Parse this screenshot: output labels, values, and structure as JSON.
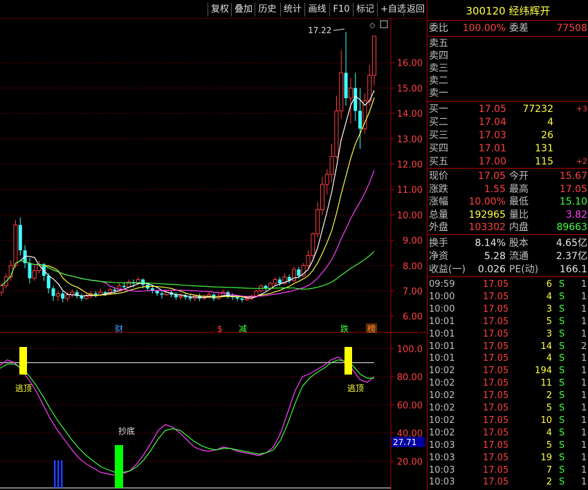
{
  "toolbar": {
    "buttons": [
      "复权",
      "叠加",
      "历史",
      "统计",
      "画线",
      "F10",
      "标记",
      "+自选",
      "返回"
    ]
  },
  "stock": {
    "code": "300120",
    "name": "经纬辉开"
  },
  "main_chart": {
    "price_ticks": [
      "16.00",
      "15.00",
      "14.00",
      "13.00",
      "12.00",
      "11.00",
      "10.00",
      "9.00",
      "8.00",
      "7.00",
      "6.00"
    ],
    "high_marker": "17.22",
    "event_labels": [
      "财",
      "$",
      "减",
      "跌",
      "榜"
    ]
  },
  "indicator_chart": {
    "ticks": [
      "100.0",
      "80.00",
      "60.00",
      "40.00",
      "20.00"
    ],
    "current_value": "27.71",
    "labels": {
      "escape_top_1": "逃顶",
      "escape_top_2": "逃顶",
      "bottom_buy": "抄底"
    }
  },
  "quote": {
    "weibi_label": "委比",
    "weibi_value": "100.00%",
    "weicha_label": "委差",
    "weicha_value": "77508",
    "sell": [
      {
        "label": "卖五"
      },
      {
        "label": "卖四"
      },
      {
        "label": "卖三"
      },
      {
        "label": "卖二"
      },
      {
        "label": "卖一"
      }
    ],
    "buy": [
      {
        "label": "买一",
        "price": "17.05",
        "vol": "77232",
        "chg": "+3"
      },
      {
        "label": "买二",
        "price": "17.04",
        "vol": "4",
        "chg": ""
      },
      {
        "label": "买三",
        "price": "17.03",
        "vol": "26",
        "chg": ""
      },
      {
        "label": "买四",
        "price": "17.01",
        "vol": "131",
        "chg": ""
      },
      {
        "label": "买五",
        "price": "17.00",
        "vol": "115",
        "chg": "+2"
      }
    ],
    "stats": [
      {
        "l1": "现价",
        "v1": "17.05",
        "c1": "red",
        "l2": "今开",
        "v2": "15.67",
        "c2": "red"
      },
      {
        "l1": "涨跌",
        "v1": "1.55",
        "c1": "red",
        "l2": "最高",
        "v2": "17.05",
        "c2": "red"
      },
      {
        "l1": "涨幅",
        "v1": "10.00%",
        "c1": "red",
        "l2": "最低",
        "v2": "15.10",
        "c2": "green"
      },
      {
        "l1": "总量",
        "v1": "192965",
        "c1": "yellow",
        "l2": "量比",
        "v2": "3.82",
        "c2": "magenta"
      },
      {
        "l1": "外盘",
        "v1": "103302",
        "c1": "red",
        "l2": "内盘",
        "v2": "89663",
        "c2": "green"
      }
    ],
    "stats2": [
      {
        "l1": "换手",
        "v1": "8.14%",
        "l2": "股本",
        "v2": "4.65亿"
      },
      {
        "l1": "净资",
        "v1": "5.28",
        "l2": "流通",
        "v2": "2.37亿"
      },
      {
        "l1": "收益(一)",
        "v1": "0.026",
        "l2": "PE(动)",
        "v2": "166.1"
      }
    ]
  },
  "ticks": [
    {
      "time": "09:59",
      "price": "17.05",
      "vol": "6",
      "side": "S",
      "cnt": "1"
    },
    {
      "time": "10:00",
      "price": "17.05",
      "vol": "4",
      "side": "S",
      "cnt": "1"
    },
    {
      "time": "10:00",
      "price": "17.05",
      "vol": "3",
      "side": "S",
      "cnt": "1"
    },
    {
      "time": "10:01",
      "price": "17.05",
      "vol": "5",
      "side": "S",
      "cnt": "1"
    },
    {
      "time": "10:01",
      "price": "17.05",
      "vol": "3",
      "side": "S",
      "cnt": "1"
    },
    {
      "time": "10:01",
      "price": "17.05",
      "vol": "14",
      "side": "S",
      "cnt": "2"
    },
    {
      "time": "10:01",
      "price": "17.05",
      "vol": "4",
      "side": "S",
      "cnt": "1"
    },
    {
      "time": "10:02",
      "price": "17.05",
      "vol": "194",
      "side": "S",
      "cnt": "1"
    },
    {
      "time": "10:02",
      "price": "17.05",
      "vol": "11",
      "side": "S",
      "cnt": "1"
    },
    {
      "time": "10:02",
      "price": "17.05",
      "vol": "2",
      "side": "S",
      "cnt": "1"
    },
    {
      "time": "10:02",
      "price": "17.05",
      "vol": "5",
      "side": "S",
      "cnt": "1"
    },
    {
      "time": "10:02",
      "price": "17.05",
      "vol": "10",
      "side": "S",
      "cnt": "1"
    },
    {
      "time": "10:02",
      "price": "17.05",
      "vol": "4",
      "side": "S",
      "cnt": "1"
    },
    {
      "time": "10:03",
      "price": "17.05",
      "vol": "5",
      "side": "S",
      "cnt": "1"
    },
    {
      "time": "10:03",
      "price": "17.05",
      "vol": "19",
      "side": "S",
      "cnt": "1"
    },
    {
      "time": "10:03",
      "price": "17.05",
      "vol": "7",
      "side": "S",
      "cnt": "1"
    },
    {
      "time": "10:03",
      "price": "17.05",
      "vol": "2",
      "side": "S",
      "cnt": "1"
    }
  ],
  "colors": {
    "up": "#ff4040",
    "down": "#40ffff",
    "ma5": "#ffffff",
    "ma10": "#ffff40",
    "ma20": "#ff40ff",
    "ma60": "#40ff40",
    "grid": "#b00000"
  },
  "chart_data": {
    "type": "candlestick",
    "price_range": [
      5.5,
      17.6
    ],
    "candles": [
      [
        6.95,
        7.2,
        6.8,
        7.3
      ],
      [
        7.2,
        7.55,
        7.1,
        7.7
      ],
      [
        7.55,
        8.0,
        7.4,
        8.2
      ],
      [
        8.0,
        9.6,
        7.9,
        9.8
      ],
      [
        9.6,
        8.6,
        8.4,
        9.9
      ],
      [
        8.6,
        8.1,
        7.9,
        8.8
      ],
      [
        8.1,
        7.5,
        7.3,
        8.3
      ],
      [
        7.5,
        7.8,
        7.4,
        8.0
      ],
      [
        7.8,
        8.05,
        7.7,
        8.2
      ],
      [
        8.05,
        7.6,
        7.4,
        8.1
      ],
      [
        7.6,
        7.1,
        6.9,
        7.7
      ],
      [
        7.1,
        6.8,
        6.6,
        7.2
      ],
      [
        6.8,
        6.9,
        6.6,
        7.0
      ],
      [
        6.9,
        6.7,
        6.55,
        7.0
      ],
      [
        6.7,
        6.85,
        6.6,
        6.95
      ],
      [
        6.85,
        6.95,
        6.75,
        7.05
      ],
      [
        6.95,
        6.8,
        6.7,
        7.05
      ],
      [
        6.8,
        6.7,
        6.6,
        6.9
      ],
      [
        6.7,
        6.8,
        6.65,
        6.9
      ],
      [
        6.8,
        6.9,
        6.7,
        7.0
      ],
      [
        6.9,
        6.85,
        6.75,
        7.0
      ],
      [
        6.85,
        6.95,
        6.8,
        7.1
      ],
      [
        6.95,
        6.9,
        6.8,
        7.0
      ],
      [
        6.9,
        7.05,
        6.85,
        7.15
      ],
      [
        7.05,
        7.0,
        6.9,
        7.15
      ],
      [
        7.0,
        7.2,
        6.95,
        7.3
      ],
      [
        7.2,
        7.15,
        7.05,
        7.35
      ],
      [
        7.15,
        7.35,
        7.1,
        7.45
      ],
      [
        7.35,
        7.3,
        7.15,
        7.45
      ],
      [
        7.3,
        7.45,
        7.25,
        7.55
      ],
      [
        7.45,
        7.25,
        7.1,
        7.5
      ],
      [
        7.25,
        7.1,
        7.0,
        7.3
      ],
      [
        7.1,
        7.0,
        6.9,
        7.2
      ],
      [
        7.0,
        6.9,
        6.8,
        7.05
      ],
      [
        6.9,
        6.85,
        6.7,
        7.0
      ],
      [
        6.85,
        6.95,
        6.8,
        7.05
      ],
      [
        6.95,
        6.85,
        6.75,
        7.0
      ],
      [
        6.85,
        6.75,
        6.65,
        6.95
      ],
      [
        6.75,
        6.8,
        6.65,
        6.9
      ],
      [
        6.8,
        6.75,
        6.65,
        6.9
      ],
      [
        6.75,
        6.7,
        6.6,
        6.85
      ],
      [
        6.7,
        6.8,
        6.6,
        6.85
      ],
      [
        6.8,
        6.7,
        6.6,
        6.9
      ],
      [
        6.7,
        6.75,
        6.65,
        6.85
      ],
      [
        6.75,
        6.85,
        6.7,
        6.95
      ],
      [
        6.85,
        6.7,
        6.6,
        6.9
      ],
      [
        6.7,
        6.8,
        6.65,
        6.9
      ],
      [
        6.8,
        6.95,
        6.75,
        7.05
      ],
      [
        6.95,
        6.8,
        6.7,
        7.0
      ],
      [
        6.8,
        6.75,
        6.65,
        6.9
      ],
      [
        6.75,
        6.7,
        6.6,
        6.8
      ],
      [
        6.7,
        6.65,
        6.55,
        6.75
      ],
      [
        6.65,
        6.7,
        6.6,
        6.75
      ],
      [
        6.7,
        6.8,
        6.65,
        6.85
      ],
      [
        6.8,
        7.0,
        6.75,
        7.05
      ],
      [
        7.0,
        7.2,
        6.95,
        7.25
      ],
      [
        7.2,
        7.1,
        7.0,
        7.25
      ],
      [
        7.1,
        7.3,
        7.05,
        7.35
      ],
      [
        7.3,
        7.45,
        7.2,
        7.55
      ],
      [
        7.45,
        7.3,
        7.2,
        7.55
      ],
      [
        7.3,
        7.55,
        7.25,
        7.7
      ],
      [
        7.55,
        7.4,
        7.3,
        7.65
      ],
      [
        7.4,
        7.85,
        7.35,
        7.95
      ],
      [
        7.85,
        7.6,
        7.5,
        7.95
      ],
      [
        7.6,
        8.0,
        7.55,
        8.1
      ],
      [
        8.0,
        8.4,
        7.9,
        8.6
      ],
      [
        8.4,
        9.25,
        8.3,
        9.3
      ],
      [
        9.25,
        10.2,
        9.1,
        10.5
      ],
      [
        10.2,
        11.2,
        10.0,
        11.5
      ],
      [
        11.2,
        11.6,
        10.8,
        11.8
      ],
      [
        11.6,
        12.3,
        11.3,
        12.8
      ],
      [
        12.3,
        14.1,
        12.2,
        14.7
      ],
      [
        14.1,
        15.6,
        13.8,
        16.5
      ],
      [
        15.6,
        14.6,
        14.3,
        17.22
      ],
      [
        14.6,
        15.0,
        13.6,
        15.4
      ],
      [
        15.0,
        14.1,
        13.7,
        15.6
      ],
      [
        14.1,
        13.4,
        12.6,
        15.0
      ],
      [
        13.4,
        14.5,
        13.2,
        14.8
      ],
      [
        14.5,
        15.5,
        14.3,
        15.9
      ],
      [
        15.5,
        17.05,
        15.1,
        17.05
      ]
    ],
    "ma_series": [
      "MA5",
      "MA10",
      "MA20",
      "MA60"
    ],
    "indicator_range": [
      0,
      110
    ],
    "indicator_threshold": 90,
    "indicator_k": [
      88,
      92,
      90,
      85,
      78,
      70,
      60,
      50,
      42,
      35,
      28,
      22,
      18,
      15,
      12,
      11,
      10,
      11,
      13,
      18,
      25,
      33,
      42,
      46,
      44,
      40,
      35,
      30,
      28,
      27,
      28,
      30,
      29,
      27,
      26,
      25,
      24,
      26,
      30,
      40,
      55,
      70,
      80,
      82,
      85,
      88,
      92,
      94,
      90,
      85,
      78,
      76,
      80
    ],
    "indicator_d": [
      86,
      89,
      89,
      86,
      81,
      74,
      66,
      57,
      49,
      42,
      35,
      29,
      24,
      20,
      16,
      14,
      12,
      12,
      13,
      16,
      21,
      28,
      36,
      42,
      43,
      42,
      38,
      34,
      31,
      29,
      28,
      29,
      29,
      28,
      27,
      26,
      25,
      26,
      28,
      35,
      47,
      61,
      73,
      79,
      83,
      86,
      90,
      92,
      91,
      88,
      82,
      79,
      79
    ]
  }
}
